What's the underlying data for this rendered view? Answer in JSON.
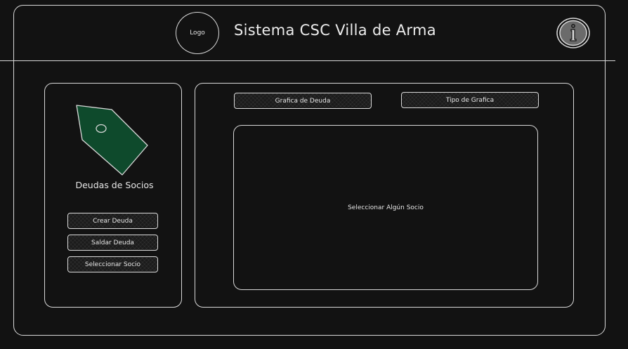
{
  "header": {
    "logo_label": "Logo",
    "title": "Sistema CSC Villa de Arma",
    "info_icon": "info-icon"
  },
  "sidebar": {
    "icon": "tag-icon",
    "title": "Deudas de Socios",
    "buttons": [
      {
        "label": "Crear Deuda"
      },
      {
        "label": "Saldar Deuda"
      },
      {
        "label": "Seleccionar Socio"
      }
    ]
  },
  "main": {
    "chart_button": "Grafica de Deuda",
    "chart_type_button": "Tipo de Grafica",
    "placeholder": "Seleccionar Algún Socio"
  },
  "colors": {
    "background": "#121212",
    "stroke": "#d9d9d9",
    "tag_fill": "#0e4a2c"
  }
}
